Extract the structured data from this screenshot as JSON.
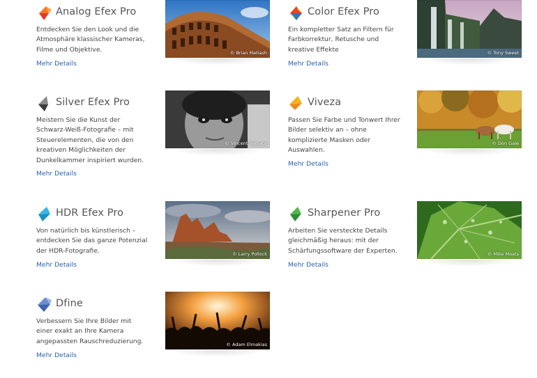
{
  "products": [
    {
      "title": "Analog Efex Pro",
      "description": "Entdecken Sie den Look und die Atmosphäre klassischer Kameras, Filme und Objektive.",
      "more": "Mehr Details",
      "credit": "© Brian Matiash",
      "icon": "analog-efex-logo-icon",
      "colors": [
        "#f47a20",
        "#e23b2a"
      ]
    },
    {
      "title": "Color Efex Pro",
      "description": "Ein kompletter Satz an Filtern für Farbkorrektur, Retusche und kreative Effekte",
      "more": "Mehr Details",
      "credit": "© Tony Sweet",
      "icon": "color-efex-logo-icon",
      "colors": [
        "#e8452c",
        "#3c6fb6"
      ]
    },
    {
      "title": "Silver Efex Pro",
      "description": "Meistern Sie die Kunst der Schwarz-Weiß-Fotografie – mit Steuerelementen, die von den kreativen Möglichkeiten der Dunkelkammer inspiriert wurden.",
      "more": "Mehr Details",
      "credit": "© Vincent Versace",
      "icon": "silver-efex-logo-icon",
      "colors": [
        "#7a7a7a",
        "#3a3a3a"
      ]
    },
    {
      "title": "Viveza",
      "description": "Passen Sie Farbe und Tonwert Ihrer Bilder selektiv an – ohne komplizierte Masken oder Auswahlen.",
      "more": "Mehr Details",
      "credit": "© Don Gale",
      "icon": "viveza-logo-icon",
      "colors": [
        "#f6b21e",
        "#f08a1a"
      ]
    },
    {
      "title": "HDR Efex Pro",
      "description": "Von natürlich bis künstlerisch – entdecken Sie das ganze Potenzial der HDR-Fotografie.",
      "more": "Mehr Details",
      "credit": "© Larry Pollock",
      "icon": "hdr-efex-logo-icon",
      "colors": [
        "#37b7e6",
        "#1e8fc6"
      ]
    },
    {
      "title": "Sharpener Pro",
      "description": "Arbeiten Sie versteckte Details gleichmäßig heraus: mit der Schärfungssoftware der Experten.",
      "more": "Mehr Details",
      "credit": "© Mike Moats",
      "icon": "sharpener-logo-icon",
      "colors": [
        "#53b84a",
        "#2c8f3a"
      ]
    },
    {
      "title": "Dfine",
      "description": "Verbessern Sie Ihre Bilder mit einer exakt an Ihre Kamera angepassten Rauschreduzierung.",
      "more": "Mehr Details",
      "credit": "© Adam Elmakias",
      "icon": "dfine-logo-icon",
      "colors": [
        "#6a8fd0",
        "#3d63b3"
      ]
    }
  ]
}
